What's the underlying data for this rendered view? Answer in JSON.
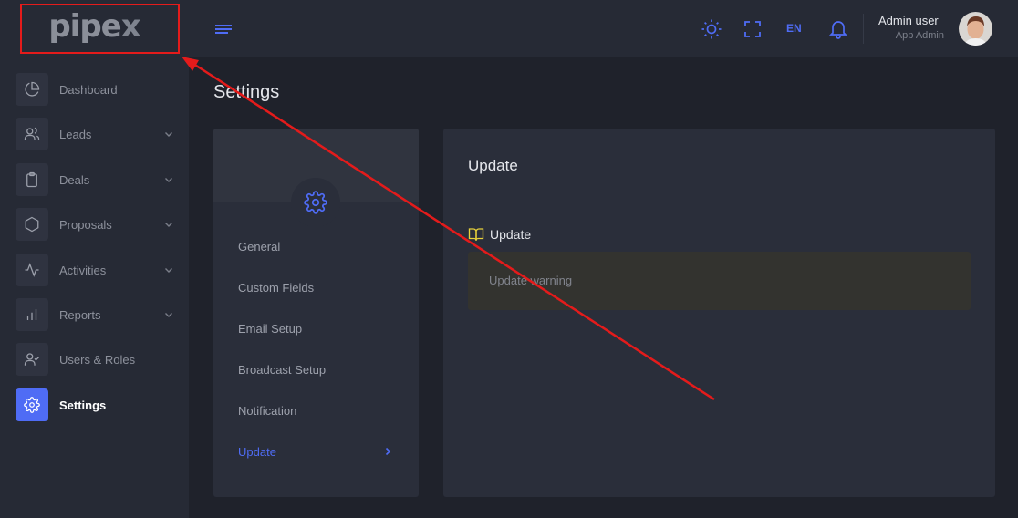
{
  "brand": {
    "logo_main": "pipe",
    "logo_x": "x"
  },
  "header": {
    "language": "EN",
    "user_name": "Admin user",
    "user_role": "App Admin"
  },
  "sidebar": {
    "items": [
      {
        "label": "Dashboard",
        "icon": "pie-chart-icon",
        "has_chevron": false
      },
      {
        "label": "Leads",
        "icon": "users-icon",
        "has_chevron": true
      },
      {
        "label": "Deals",
        "icon": "clipboard-icon",
        "has_chevron": true
      },
      {
        "label": "Proposals",
        "icon": "hexagon-icon",
        "has_chevron": true
      },
      {
        "label": "Activities",
        "icon": "activity-icon",
        "has_chevron": true
      },
      {
        "label": "Reports",
        "icon": "bar-chart-icon",
        "has_chevron": true
      },
      {
        "label": "Users & Roles",
        "icon": "user-check-icon",
        "has_chevron": false
      },
      {
        "label": "Settings",
        "icon": "gear-icon",
        "has_chevron": false,
        "active": true
      }
    ]
  },
  "main": {
    "page_title": "Settings",
    "settings_menu": [
      {
        "label": "General"
      },
      {
        "label": "Custom Fields"
      },
      {
        "label": "Email Setup"
      },
      {
        "label": "Broadcast Setup"
      },
      {
        "label": "Notification"
      },
      {
        "label": "Update",
        "active": true
      }
    ],
    "update_panel": {
      "title": "Update",
      "subtitle": "Update",
      "warning": "Update warning"
    }
  },
  "colors": {
    "accent": "#4f6cf5",
    "annotation": "#e41b1b",
    "book_icon": "#e8d13a"
  }
}
